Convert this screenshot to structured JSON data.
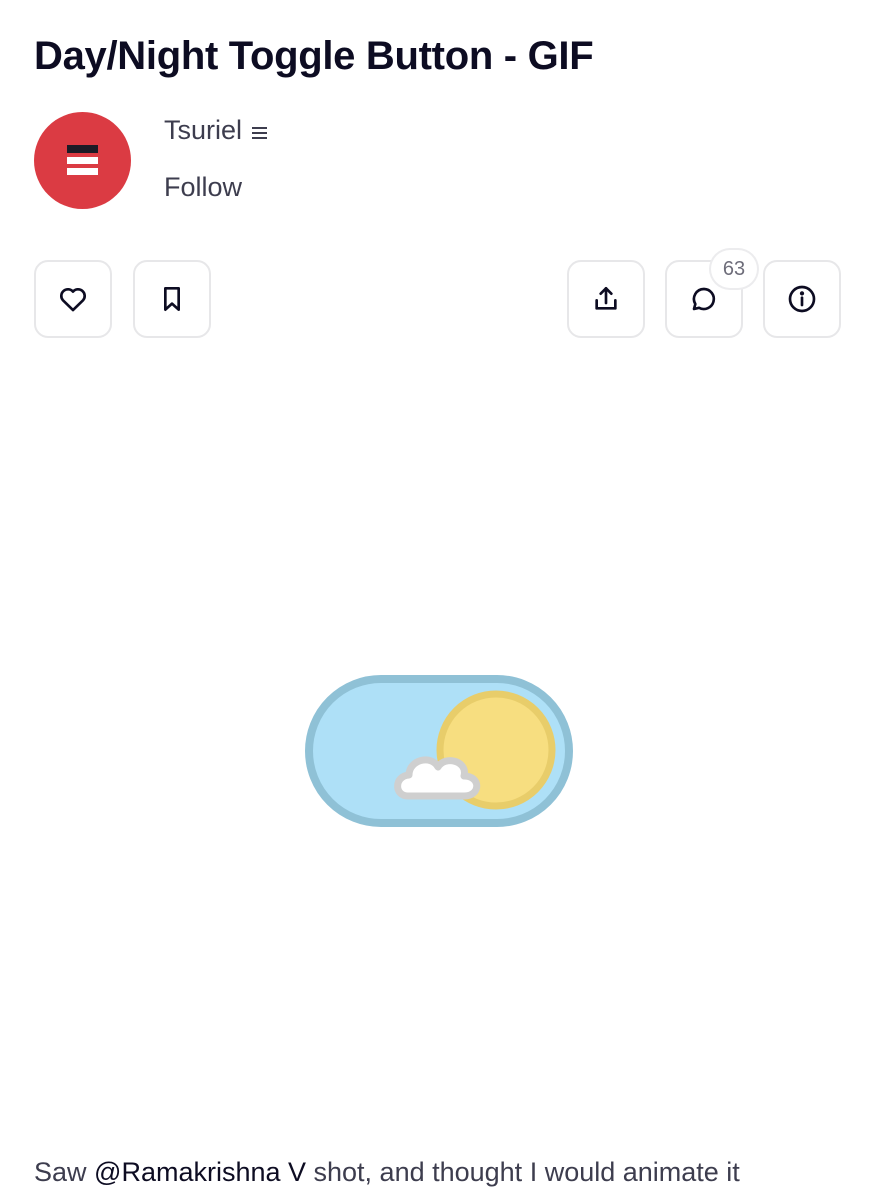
{
  "shot": {
    "title": "Day/Night Toggle Button - GIF"
  },
  "author": {
    "name": "Tsuriel",
    "follow_label": "Follow",
    "avatar_color": "#db3b43"
  },
  "actions": {
    "like_icon": "heart-icon",
    "save_icon": "bookmark-icon",
    "share_icon": "share-upload-icon",
    "comment_icon": "comment-bubble-icon",
    "comment_count": "63",
    "info_icon": "info-icon"
  },
  "description": {
    "prefix": "Saw ",
    "mention": "@Ramakrishna V",
    "suffix": " shot, and thought I would animate it"
  },
  "colors": {
    "toggle_track": "#aee0f7",
    "toggle_border": "#8fc1d6",
    "sun": "#f7de80",
    "sun_ring": "#e8cd6a",
    "cloud": "#ffffff",
    "cloud_outline": "#cfcfcf"
  }
}
